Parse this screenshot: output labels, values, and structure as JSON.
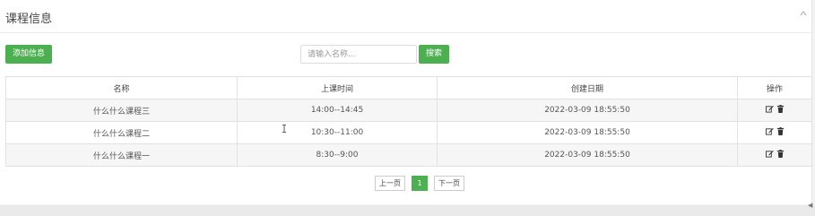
{
  "panel": {
    "title": "课程信息",
    "collapse_icon": "chevron-up-icon"
  },
  "toolbar": {
    "add_label": "添加信息",
    "search_placeholder": "请输入名称...",
    "search_value": "",
    "search_label": "搜索"
  },
  "table": {
    "columns": [
      "名称",
      "上课时间",
      "创建日期",
      "操作"
    ],
    "rows": [
      {
        "name": "什么什么课程三",
        "time": "14:00--14:45",
        "created": "2022-03-09 18:55:50"
      },
      {
        "name": "什么什么课程二",
        "time": "10:30--11:00",
        "created": "2022-03-09 18:55:50"
      },
      {
        "name": "什么什么课程一",
        "time": "8:30--9:00",
        "created": "2022-03-09 18:55:50"
      }
    ],
    "action_icons": [
      "edit-icon",
      "trash-icon"
    ]
  },
  "pagination": {
    "prev_label": "上一页",
    "current_page": "1",
    "next_label": "下一页"
  },
  "colors": {
    "accent": "#4caf50"
  }
}
